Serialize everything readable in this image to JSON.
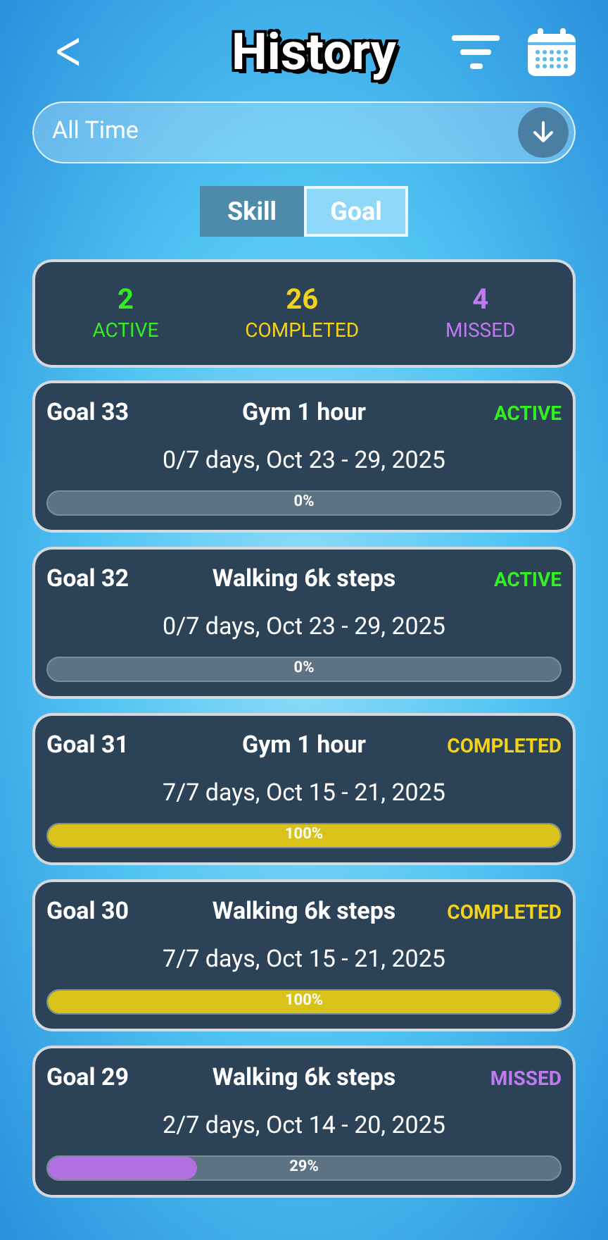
{
  "header": {
    "back": "<",
    "title": "History"
  },
  "filter": {
    "value": "All Time"
  },
  "tabs": [
    {
      "label": "Skill",
      "selected": false
    },
    {
      "label": "Goal",
      "selected": true
    }
  ],
  "summary": [
    {
      "kind": "active",
      "count": "2",
      "label": "ACTIVE"
    },
    {
      "kind": "completed",
      "count": "26",
      "label": "COMPLETED"
    },
    {
      "kind": "missed",
      "count": "4",
      "label": "MISSED"
    }
  ],
  "goals": [
    {
      "number": "Goal 33",
      "name": "Gym 1 hour",
      "kind": "active",
      "status": "ACTIVE",
      "detail": "0/7 days, Oct 23 - 29, 2025",
      "level": 0,
      "percent": "0%"
    },
    {
      "number": "Goal 32",
      "name": "Walking 6k steps",
      "kind": "active",
      "status": "ACTIVE",
      "detail": "0/7 days, Oct 23 - 29, 2025",
      "level": 0,
      "percent": "0%"
    },
    {
      "number": "Goal 31",
      "name": "Gym 1 hour",
      "kind": "completed",
      "status": "COMPLETED",
      "detail": "7/7 days, Oct 15 - 21, 2025",
      "level": 1,
      "percent": "100%"
    },
    {
      "number": "Goal 30",
      "name": "Walking 6k steps",
      "kind": "completed",
      "status": "COMPLETED",
      "detail": "7/7 days, Oct 15 - 21, 2025",
      "level": 1,
      "percent": "100%"
    },
    {
      "number": "Goal 29",
      "name": "Walking 6k steps",
      "kind": "missed",
      "status": "MISSED",
      "detail": "2/7 days, Oct 14 - 20, 2025",
      "level": 0.29,
      "percent": "29%"
    }
  ]
}
